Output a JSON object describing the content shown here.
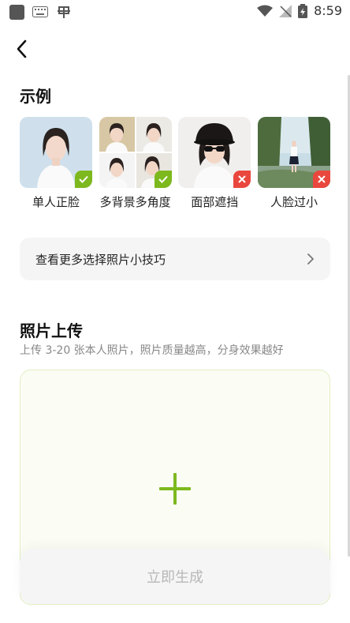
{
  "status_bar": {
    "time": "8:59"
  },
  "examples": {
    "title": "示例",
    "items": [
      {
        "caption": "单人正脸",
        "valid": true
      },
      {
        "caption": "多背景多角度",
        "valid": true
      },
      {
        "caption": "面部遮挡",
        "valid": false
      },
      {
        "caption": "人脸过小",
        "valid": false
      }
    ]
  },
  "tips": {
    "label": "查看更多选择照片小技巧"
  },
  "upload": {
    "title": "照片上传",
    "subtitle": "上传 3-20 张本人照片，照片质量越高，分身效果越好"
  },
  "generate_button": {
    "label": "立即生成"
  },
  "colors": {
    "accent": "#7db91e",
    "error": "#e9473d"
  }
}
